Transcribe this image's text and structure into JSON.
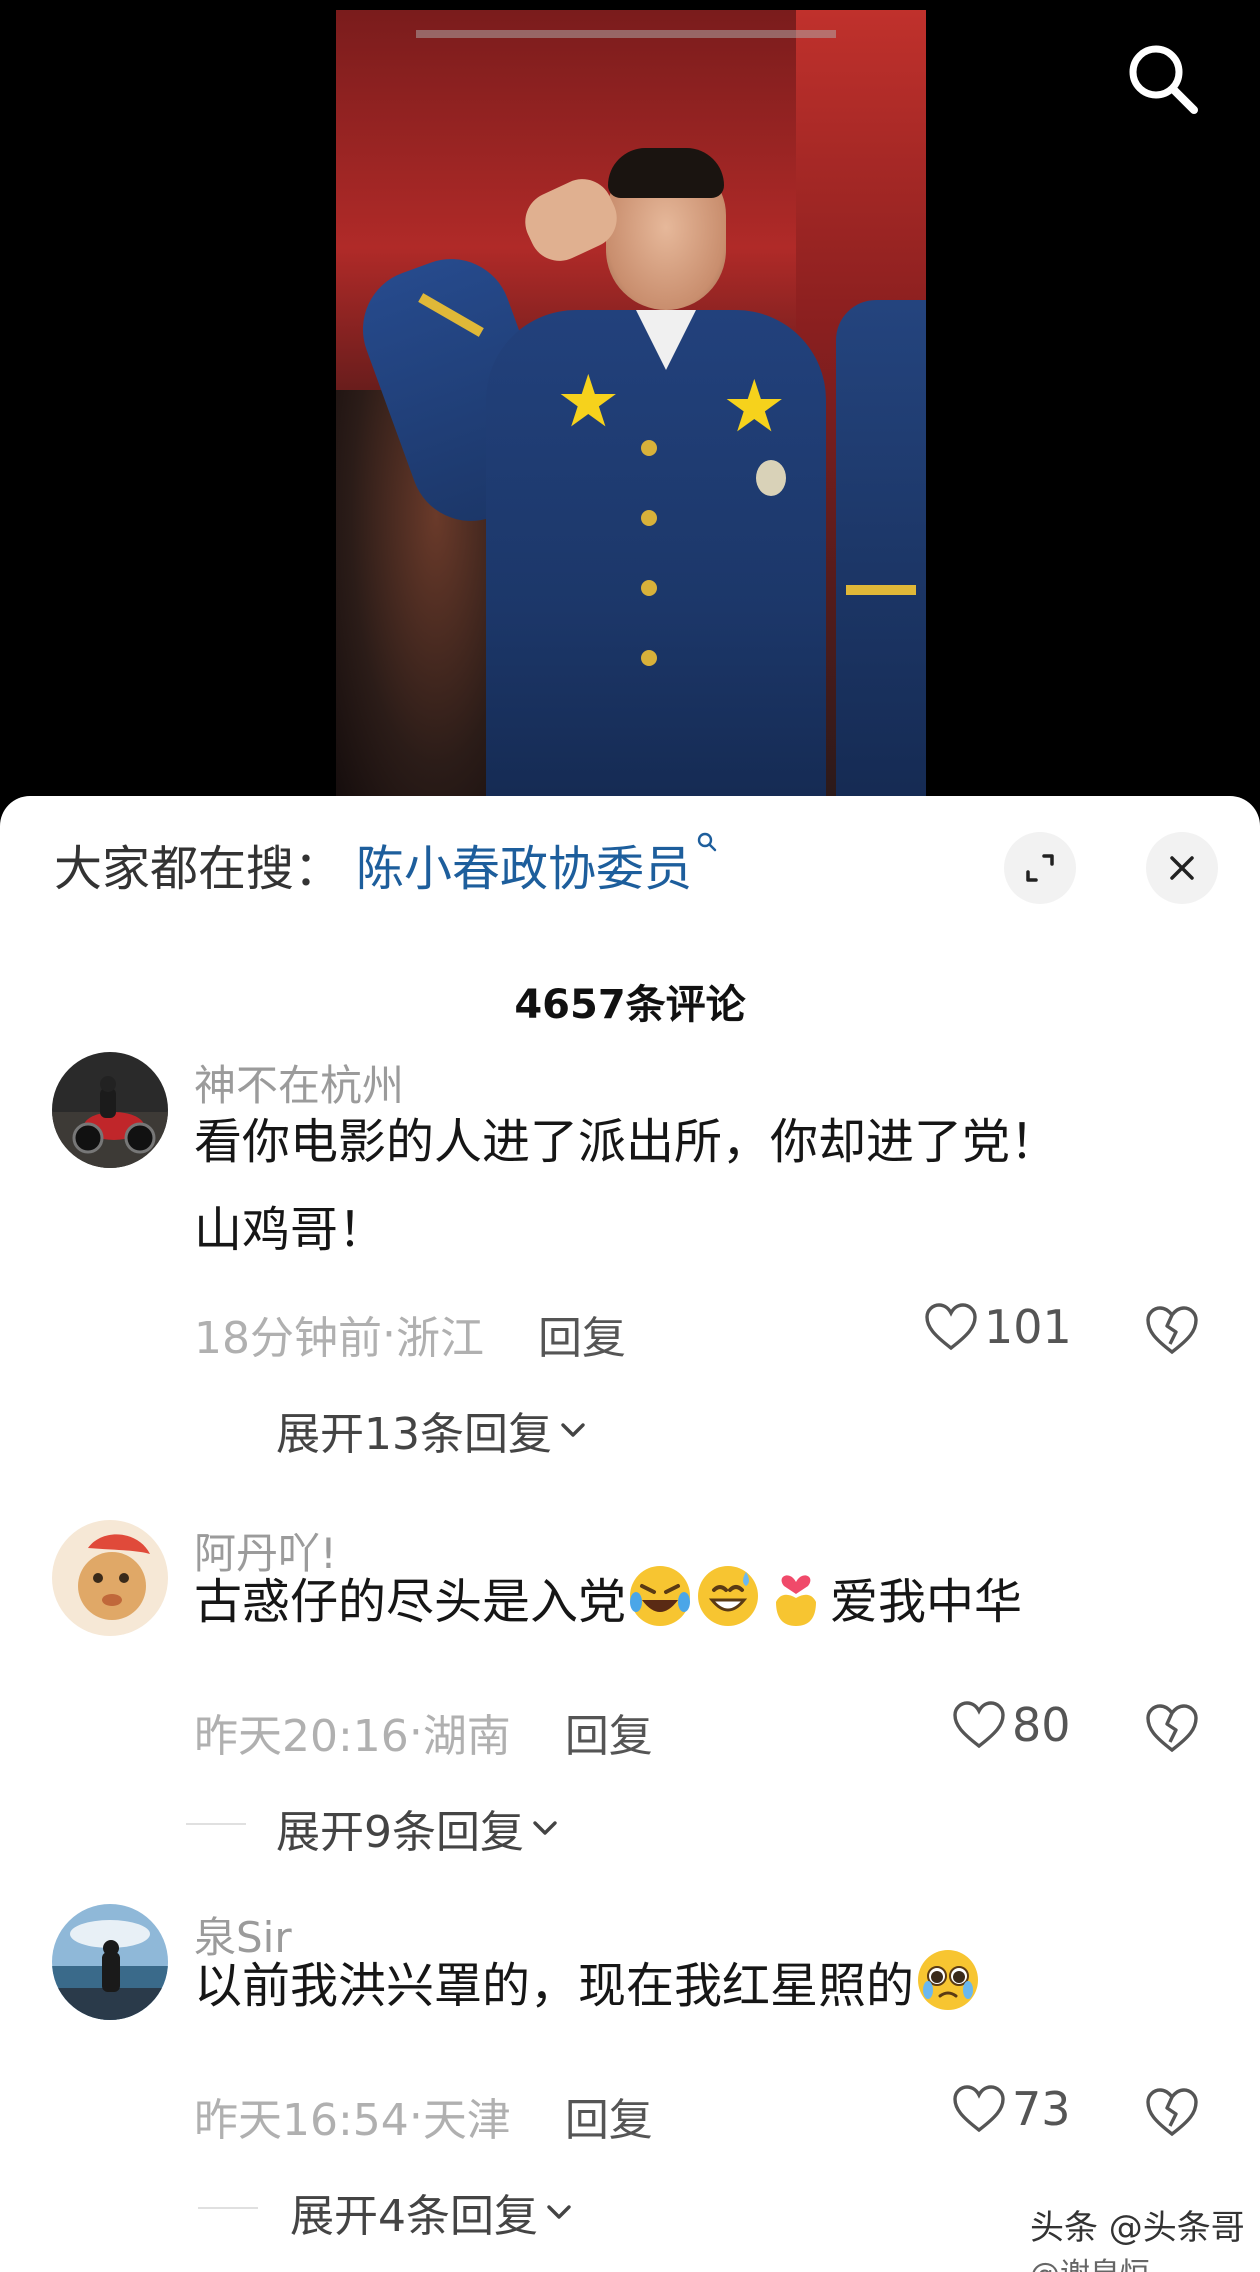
{
  "video": {
    "search_icon": "search-icon"
  },
  "hot_search": {
    "label": "大家都在搜：",
    "query": "陈小春政协委员"
  },
  "comment_count": "4657条评论",
  "comments": [
    {
      "username": "神不在杭州",
      "content_line1": "看你电影的人进了派出所，你却进了党！",
      "content_line2": "山鸡哥！",
      "time": "18分钟前",
      "location": "浙江",
      "reply": "回复",
      "likes": "101",
      "expand": "展开13条回复"
    },
    {
      "username": "阿丹吖!",
      "content_text": "古惑仔的尽头是入党",
      "content_tail": "爱我中华",
      "emojis": [
        "rofl-emoji",
        "sweat-smile-emoji",
        "heart-hands-emoji"
      ],
      "time": "昨天20:16",
      "location": "湖南",
      "reply": "回复",
      "likes": "80",
      "expand": "展开9条回复"
    },
    {
      "username": "泉Sir",
      "content_text": "以前我洪兴罩的，现在我红星照的",
      "emojis": [
        "pleading-face-emoji"
      ],
      "time": "昨天16:54",
      "location": "天津",
      "reply": "回复",
      "likes": "73",
      "expand": "展开4条回复"
    }
  ],
  "separator": " · ",
  "watermark": {
    "main": "头条 @头条哥",
    "sub": "@谢泉恒"
  },
  "colors": {
    "link": "#1d5e9c",
    "meta": "#b0b0b0",
    "star": "#f6d21c"
  }
}
